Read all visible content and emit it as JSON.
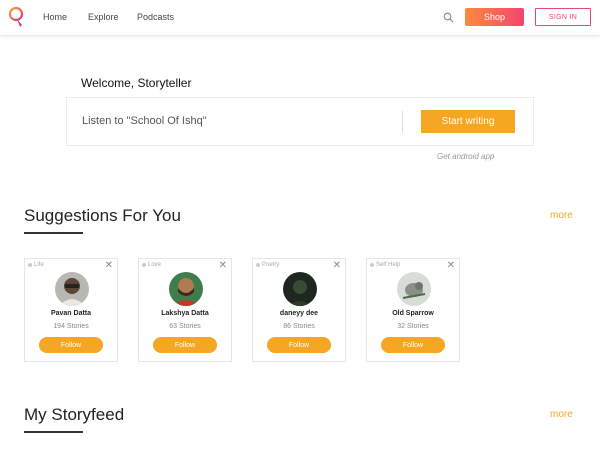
{
  "header": {
    "nav": {
      "home": "Home",
      "explore": "Explore",
      "podcasts": "Podcasts"
    },
    "shop_label": "Shop",
    "signin_label": "SIGN IN",
    "logo_icon": "storyteller-logo-icon",
    "search_icon": "search-icon"
  },
  "welcome": {
    "greeting": "Welcome, Storyteller",
    "listen_text": "Listen to \"School Of Ishq\"",
    "start_label": "Start writing",
    "android_label": "Get android app"
  },
  "suggestions": {
    "title": "Suggestions For You",
    "more_label": "more",
    "cards": [
      {
        "tag": "Life",
        "name": "Pavan Datta",
        "count": "194 Stories",
        "follow": "Follow"
      },
      {
        "tag": "Love",
        "name": "Lakshya Datta",
        "count": "63 Stories",
        "follow": "Follow"
      },
      {
        "tag": "Poetry",
        "name": "daneyy dee",
        "count": "86 Stories",
        "follow": "Follow"
      },
      {
        "tag": "Self Help",
        "name": "Old Sparrow",
        "count": "32 Stories",
        "follow": "Follow"
      }
    ]
  },
  "storyfeed": {
    "title": "My Storyfeed",
    "more_label": "more"
  },
  "colors": {
    "accent": "#f5a623",
    "brand_pink": "#e8457a"
  }
}
